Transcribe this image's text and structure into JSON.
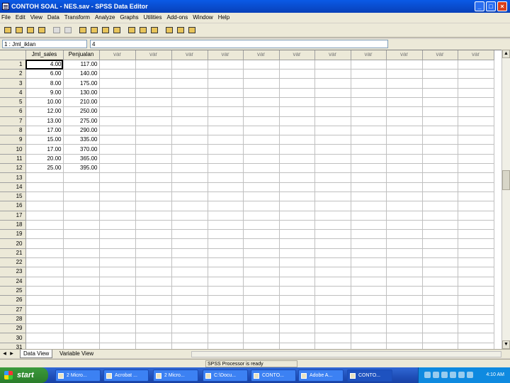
{
  "window": {
    "title": "CONTOH SOAL - NES.sav - SPSS Data Editor",
    "controls": [
      "_",
      "□",
      "×"
    ]
  },
  "menu": [
    "File",
    "Edit",
    "View",
    "Data",
    "Transform",
    "Analyze",
    "Graphs",
    "Utilities",
    "Add-ons",
    "Window",
    "Help"
  ],
  "toolbar": {
    "icons": [
      "open-icon",
      "save-icon",
      "print-icon",
      "dialog-recall-icon",
      "undo-icon",
      "redo-icon",
      "goto-chart-icon",
      "goto-case-icon",
      "find-icon",
      "insert-case-icon",
      "insert-variable-icon",
      "split-file-icon",
      "weight-cases-icon",
      "select-cases-icon",
      "value-labels-icon",
      "use-sets-icon"
    ]
  },
  "cell_editor": {
    "reference": "1 : Jml_iklan",
    "value": "4"
  },
  "grid": {
    "columns": [
      "Jml_sales",
      "Penjualan",
      "var",
      "var",
      "var",
      "var",
      "var",
      "var",
      "var",
      "var",
      "var",
      "var",
      "var"
    ],
    "rows": [
      [
        "4.00",
        "117.00"
      ],
      [
        "6.00",
        "140.00"
      ],
      [
        "8.00",
        "175.00"
      ],
      [
        "9.00",
        "130.00"
      ],
      [
        "10.00",
        "210.00"
      ],
      [
        "12.00",
        "250.00"
      ],
      [
        "13.00",
        "275.00"
      ],
      [
        "17.00",
        "290.00"
      ],
      [
        "15.00",
        "335.00"
      ],
      [
        "17.00",
        "370.00"
      ],
      [
        "20.00",
        "365.00"
      ],
      [
        "25.00",
        "395.00"
      ]
    ],
    "row_count": 31
  },
  "tabs": {
    "data_view": "Data View",
    "variable_view": "Variable View"
  },
  "status": {
    "text": "SPSS Processor is ready"
  },
  "taskbar": {
    "start_label": "start",
    "tasks": [
      "2 Micro...",
      "Acrobat ...",
      "2 Micro...",
      "C:\\Docu...",
      "CONTO...",
      "Adobe A...",
      "CONTO..."
    ],
    "clock": "4:10 AM"
  },
  "colors": {
    "titlebar": "#0a5ae6",
    "taskbar": "#1f4fb8",
    "start_button": "#2a7d2a",
    "tray": "#0f8ae0"
  }
}
